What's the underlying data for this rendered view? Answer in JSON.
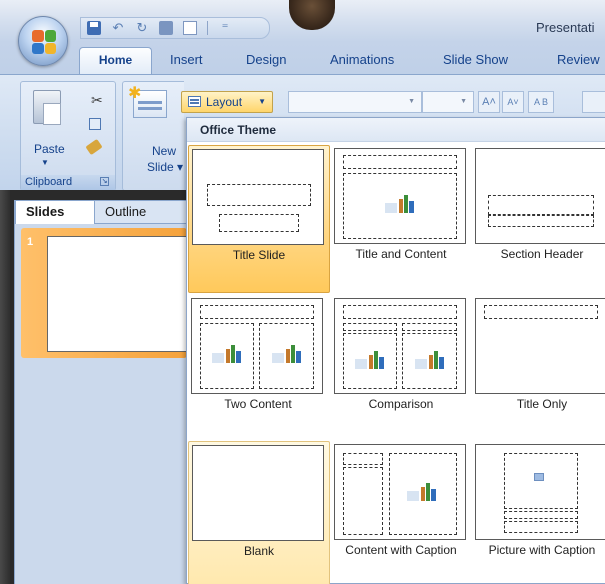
{
  "window": {
    "title": "Presentati"
  },
  "tabs": [
    "Home",
    "Insert",
    "Design",
    "Animations",
    "Slide Show",
    "Review"
  ],
  "ribbon": {
    "clipboard": {
      "paste_label": "Paste",
      "group_label": "Clipboard"
    },
    "new_slide": {
      "line1": "New",
      "line2": "Slide"
    },
    "layout_label": "Layout",
    "grow_font": "A",
    "shrink_font": "A",
    "clear_format": "A B"
  },
  "slides_panel": {
    "tabs": [
      "Slides",
      "Outline"
    ],
    "slides": [
      {
        "number": "1"
      }
    ]
  },
  "gallery": {
    "theme_name": "Office Theme",
    "layouts": [
      {
        "label": "Title Slide",
        "state": "selected"
      },
      {
        "label": "Title and Content",
        "state": "normal"
      },
      {
        "label": "Section Header",
        "state": "normal"
      },
      {
        "label": "Two Content",
        "state": "normal"
      },
      {
        "label": "Comparison",
        "state": "normal"
      },
      {
        "label": "Title Only",
        "state": "normal"
      },
      {
        "label": "Blank",
        "state": "hover"
      },
      {
        "label": "Content with Caption",
        "state": "normal"
      },
      {
        "label": "Picture with Caption",
        "state": "normal"
      }
    ]
  }
}
